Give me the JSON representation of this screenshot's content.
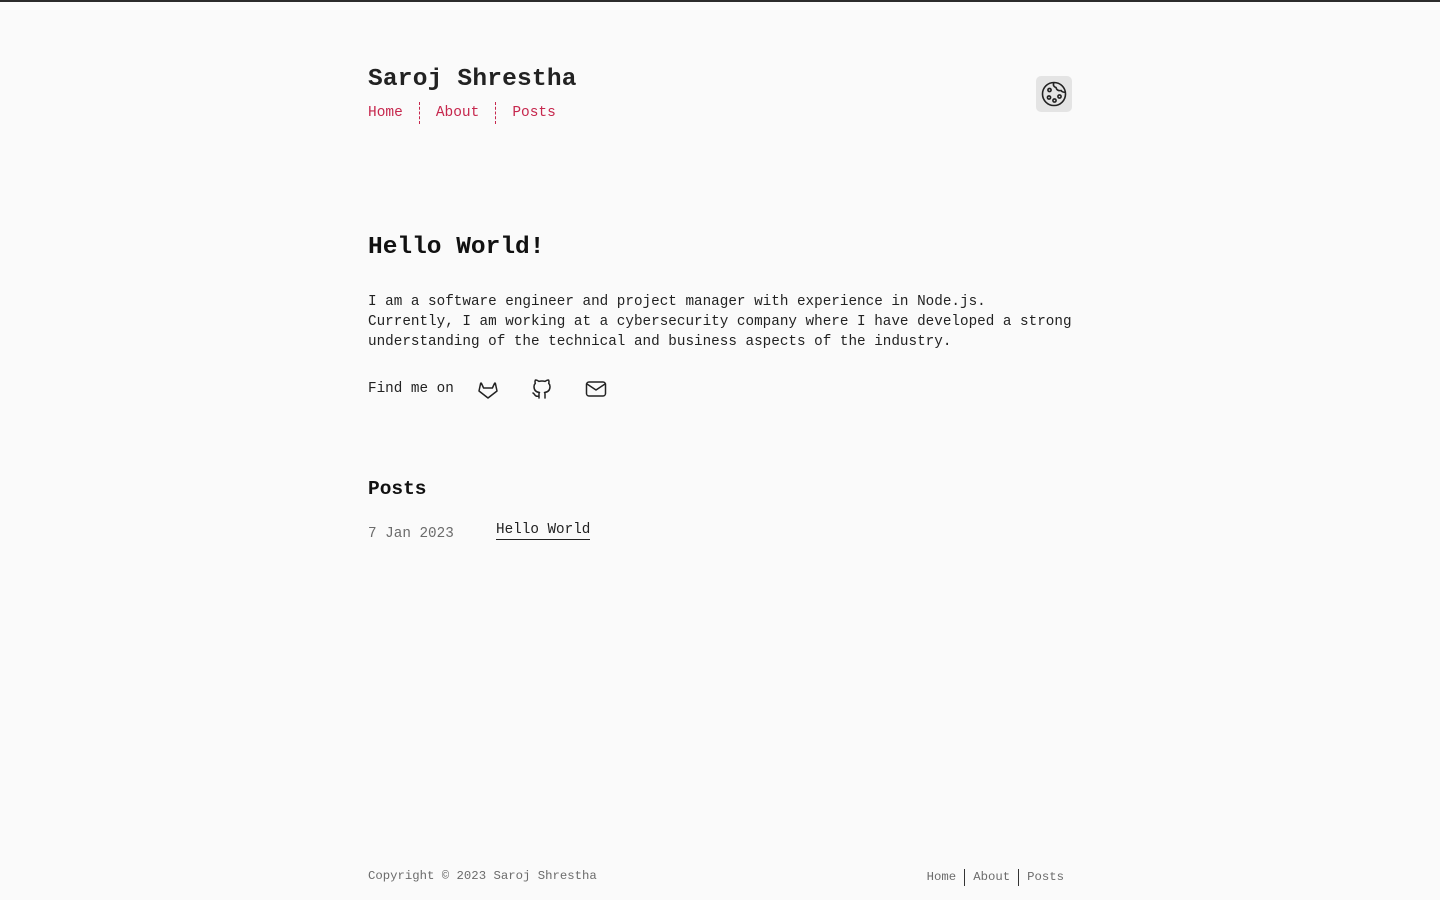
{
  "header": {
    "site_title": "Saroj Shrestha",
    "nav": [
      {
        "label": "Home"
      },
      {
        "label": "About"
      },
      {
        "label": "Posts"
      }
    ],
    "theme_toggle_icon": "cookie-icon",
    "accent_color": "#c6274d"
  },
  "hero": {
    "title": "Hello World!",
    "intro": "I am a software engineer and project manager with experience in Node.js. Currently, I am working at a cybersecurity company where I have developed a strong understanding of the technical and business aspects of the industry.",
    "find_me_label": "Find me on",
    "social_icons": [
      "gitlab-icon",
      "github-icon",
      "mail-icon"
    ]
  },
  "posts": {
    "heading": "Posts",
    "items": [
      {
        "date": "7 Jan 2023",
        "title": "Hello World"
      }
    ]
  },
  "footer": {
    "copyright": "Copyright © 2023 Saroj Shrestha",
    "nav": [
      {
        "label": "Home"
      },
      {
        "label": "About"
      },
      {
        "label": "Posts"
      }
    ]
  }
}
